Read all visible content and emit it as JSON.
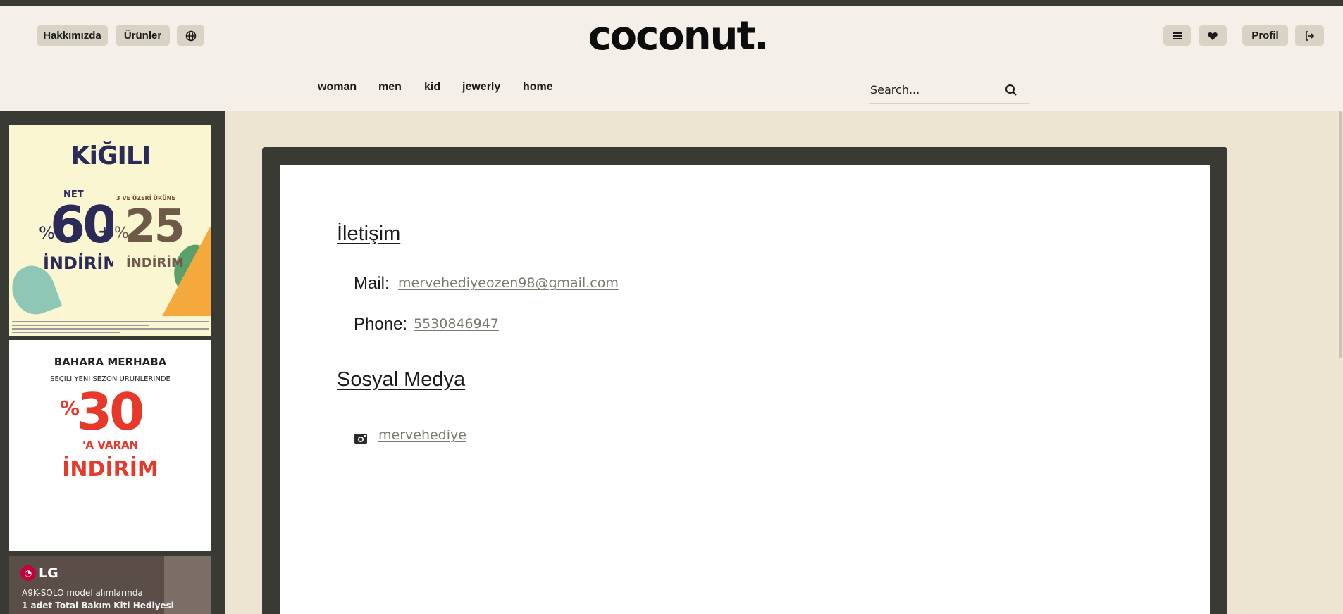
{
  "header": {
    "left_buttons": {
      "about": "Hakkımızda",
      "products": "Ürünler"
    },
    "logo_text": "coconut.",
    "right_buttons": {
      "profile": "Profil"
    },
    "nav": [
      "woman",
      "men",
      "kid",
      "jewerly",
      "home"
    ],
    "search": {
      "placeholder": "Search..."
    }
  },
  "ads": {
    "kigili": {
      "brand": "KiĞILI",
      "net": "NET",
      "pct": "%",
      "value1": "60",
      "plus": "+",
      "discount1": "İNDİRİM",
      "sub": "3 VE ÜZERİ ÜRÜNE",
      "value2": "25",
      "discount2": "İNDİRİM"
    },
    "bahara": {
      "line1": "BAHARA MERHABA",
      "line2": "SEÇİLİ YENİ SEZON ÜRÜNLERİNDE",
      "pct": "%",
      "value": "30",
      "line3": "'A VARAN",
      "line4": "İNDİRİM"
    },
    "lg": {
      "logo": "LG",
      "line1": "A9K-SOLO model alımlarında",
      "line2": "1 adet Total Bakım Kiti Hediyesi"
    }
  },
  "contact": {
    "title": "İletişim",
    "mail_label": "Mail:",
    "mail_value": "mervehediyeozen98@gmail.com",
    "phone_label": "Phone:",
    "phone_value": "5530846947",
    "social_title": "Sosyal Medya",
    "instagram_handle": "mervehediye"
  },
  "colors": {
    "header_bg": "#f4f0e9",
    "page_bg": "#ede4d2",
    "dark": "#3a3a35",
    "button_bg": "#d9d3c6",
    "link": "#7a7a6c"
  }
}
